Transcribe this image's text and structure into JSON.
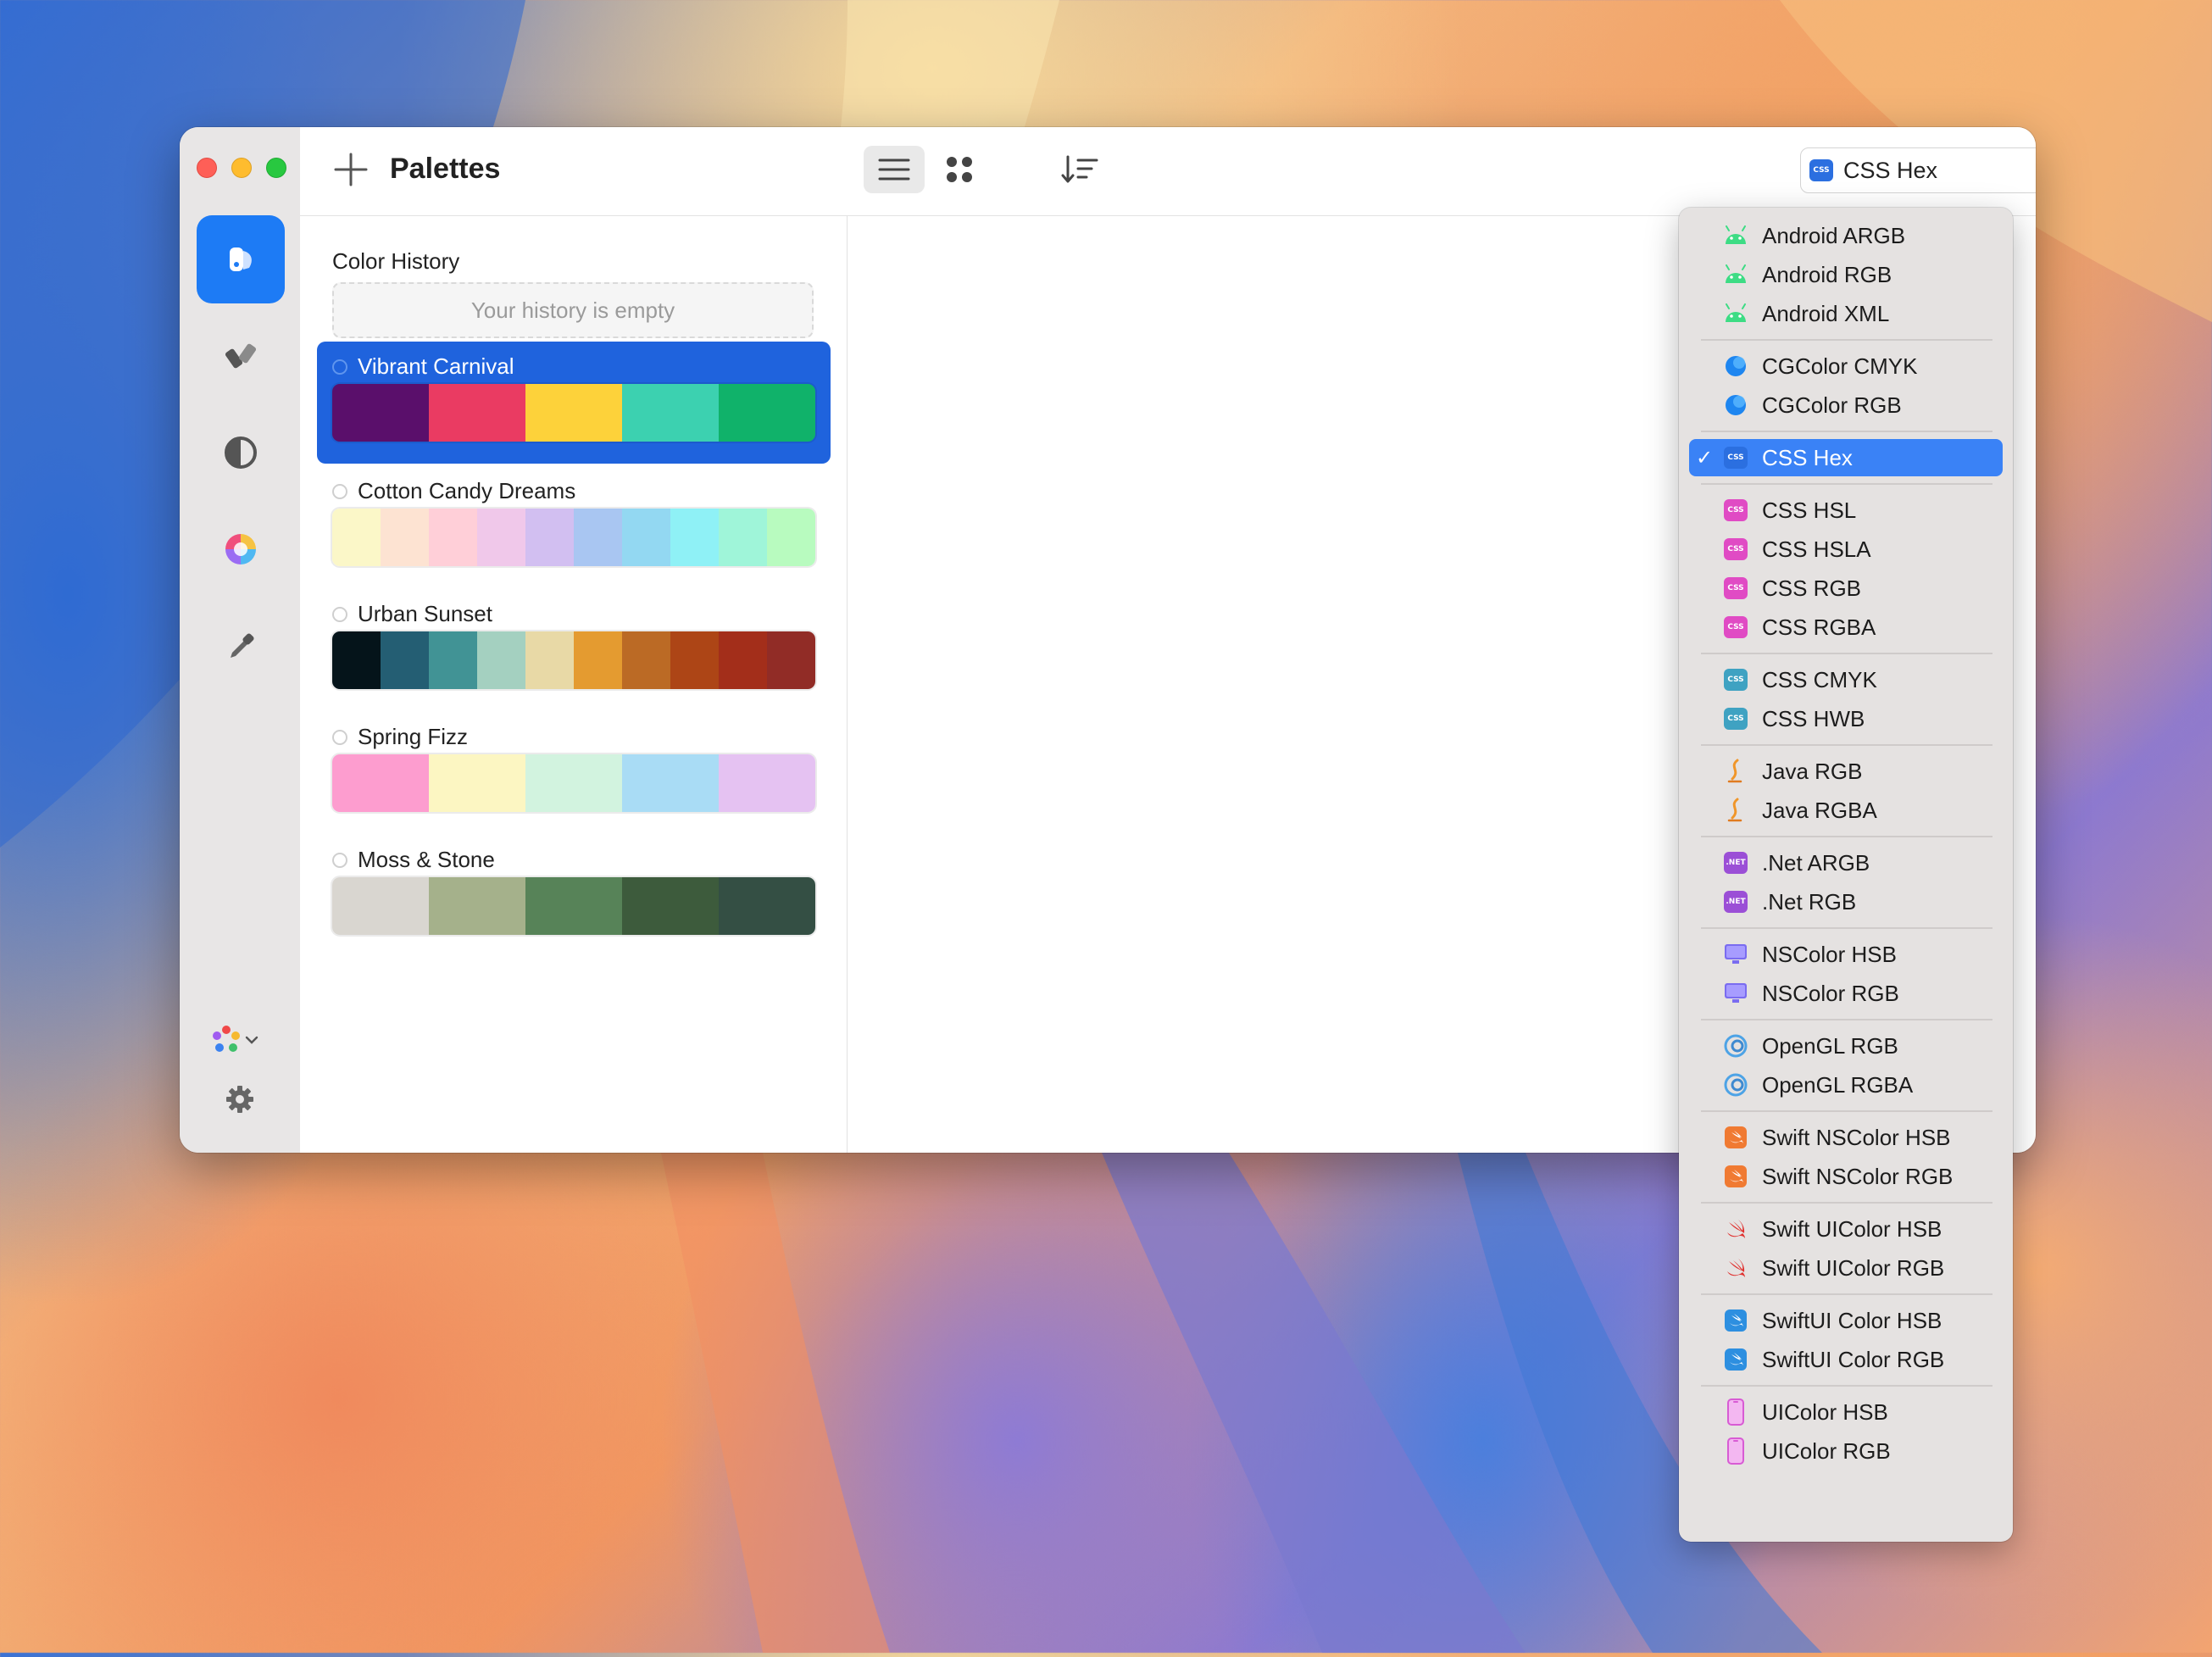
{
  "window": {
    "title": "Palettes",
    "format_selector": {
      "selected": "CSS Hex",
      "badge": "CSS"
    }
  },
  "sidebar": {
    "items": [
      {
        "name": "palettes",
        "active": true
      },
      {
        "name": "tools",
        "active": false
      },
      {
        "name": "contrast",
        "active": false
      },
      {
        "name": "color-wheel",
        "active": false
      },
      {
        "name": "eyedropper",
        "active": false
      }
    ]
  },
  "history": {
    "label": "Color History",
    "empty_text": "Your history is empty"
  },
  "palettes": [
    {
      "name": "Vibrant Carnival",
      "selected": true,
      "colors": [
        "#5a0f6b",
        "#ea3b62",
        "#fdd23a",
        "#3cd1b0",
        "#10b26a"
      ]
    },
    {
      "name": "Cotton Candy Dreams",
      "selected": false,
      "colors": [
        "#fbf7c8",
        "#fde3d2",
        "#ffcfd8",
        "#f0c8ea",
        "#d2bff1",
        "#a9c6f2",
        "#93d8f2",
        "#8ff1f6",
        "#9ff5d9",
        "#b8fbbf"
      ]
    },
    {
      "name": "Urban Sunset",
      "selected": false,
      "colors": [
        "#05141a",
        "#245e73",
        "#419395",
        "#a4d0c0",
        "#e8d9a6",
        "#e49b30",
        "#bb6a25",
        "#ad4516",
        "#a32e1a",
        "#912c26"
      ]
    },
    {
      "name": "Spring Fizz",
      "selected": false,
      "colors": [
        "#fd9dcf",
        "#fcf6c2",
        "#d2f3df",
        "#a9dcf5",
        "#e5c2f2"
      ]
    },
    {
      "name": "Moss & Stone",
      "selected": false,
      "colors": [
        "#d9d6d0",
        "#a5b18b",
        "#578358",
        "#3d5b3c",
        "#344f44"
      ]
    }
  ],
  "format_menu": {
    "groups": [
      {
        "items": [
          {
            "label": "Android ARGB",
            "icon": "android-icon"
          },
          {
            "label": "Android RGB",
            "icon": "android-icon"
          },
          {
            "label": "Android XML",
            "icon": "android-icon"
          }
        ]
      },
      {
        "items": [
          {
            "label": "CGColor CMYK",
            "icon": "cgcolor-icon"
          },
          {
            "label": "CGColor RGB",
            "icon": "cgcolor-icon"
          }
        ]
      },
      {
        "items": [
          {
            "label": "CSS Hex",
            "icon": "css-blue-icon",
            "selected": true
          }
        ]
      },
      {
        "items": [
          {
            "label": "CSS HSL",
            "icon": "css-pink-icon"
          },
          {
            "label": "CSS HSLA",
            "icon": "css-pink-icon"
          },
          {
            "label": "CSS RGB",
            "icon": "css-pink-icon"
          },
          {
            "label": "CSS RGBA",
            "icon": "css-pink-icon"
          }
        ]
      },
      {
        "items": [
          {
            "label": "CSS CMYK",
            "icon": "css-teal-icon"
          },
          {
            "label": "CSS HWB",
            "icon": "css-teal-icon"
          }
        ]
      },
      {
        "items": [
          {
            "label": "Java RGB",
            "icon": "java-icon"
          },
          {
            "label": "Java RGBA",
            "icon": "java-icon"
          }
        ]
      },
      {
        "items": [
          {
            "label": ".Net ARGB",
            "icon": "dotnet-icon"
          },
          {
            "label": ".Net RGB",
            "icon": "dotnet-icon"
          }
        ]
      },
      {
        "items": [
          {
            "label": "NSColor HSB",
            "icon": "monitor-icon"
          },
          {
            "label": "NSColor RGB",
            "icon": "monitor-icon"
          }
        ]
      },
      {
        "items": [
          {
            "label": "OpenGL RGB",
            "icon": "opengl-icon"
          },
          {
            "label": "OpenGL RGBA",
            "icon": "opengl-icon"
          }
        ]
      },
      {
        "items": [
          {
            "label": "Swift NSColor HSB",
            "icon": "swift-orange-icon"
          },
          {
            "label": "Swift NSColor RGB",
            "icon": "swift-orange-icon"
          }
        ]
      },
      {
        "items": [
          {
            "label": "Swift UIColor HSB",
            "icon": "swift-red-icon"
          },
          {
            "label": "Swift UIColor RGB",
            "icon": "swift-red-icon"
          }
        ]
      },
      {
        "items": [
          {
            "label": "SwiftUI Color HSB",
            "icon": "swiftui-icon"
          },
          {
            "label": "SwiftUI Color RGB",
            "icon": "swiftui-icon"
          }
        ]
      },
      {
        "items": [
          {
            "label": "UIColor HSB",
            "icon": "phone-icon"
          },
          {
            "label": "UIColor RGB",
            "icon": "phone-icon"
          }
        ]
      }
    ],
    "check_mark": "✓",
    "badges": {
      "css": "CSS",
      "dotnet": ".NET"
    }
  },
  "colors": {
    "accent": "#1d7bf5",
    "selection": "#1f63dd",
    "menu_selection": "#3a82f6",
    "android_green": "#3ddc84"
  }
}
